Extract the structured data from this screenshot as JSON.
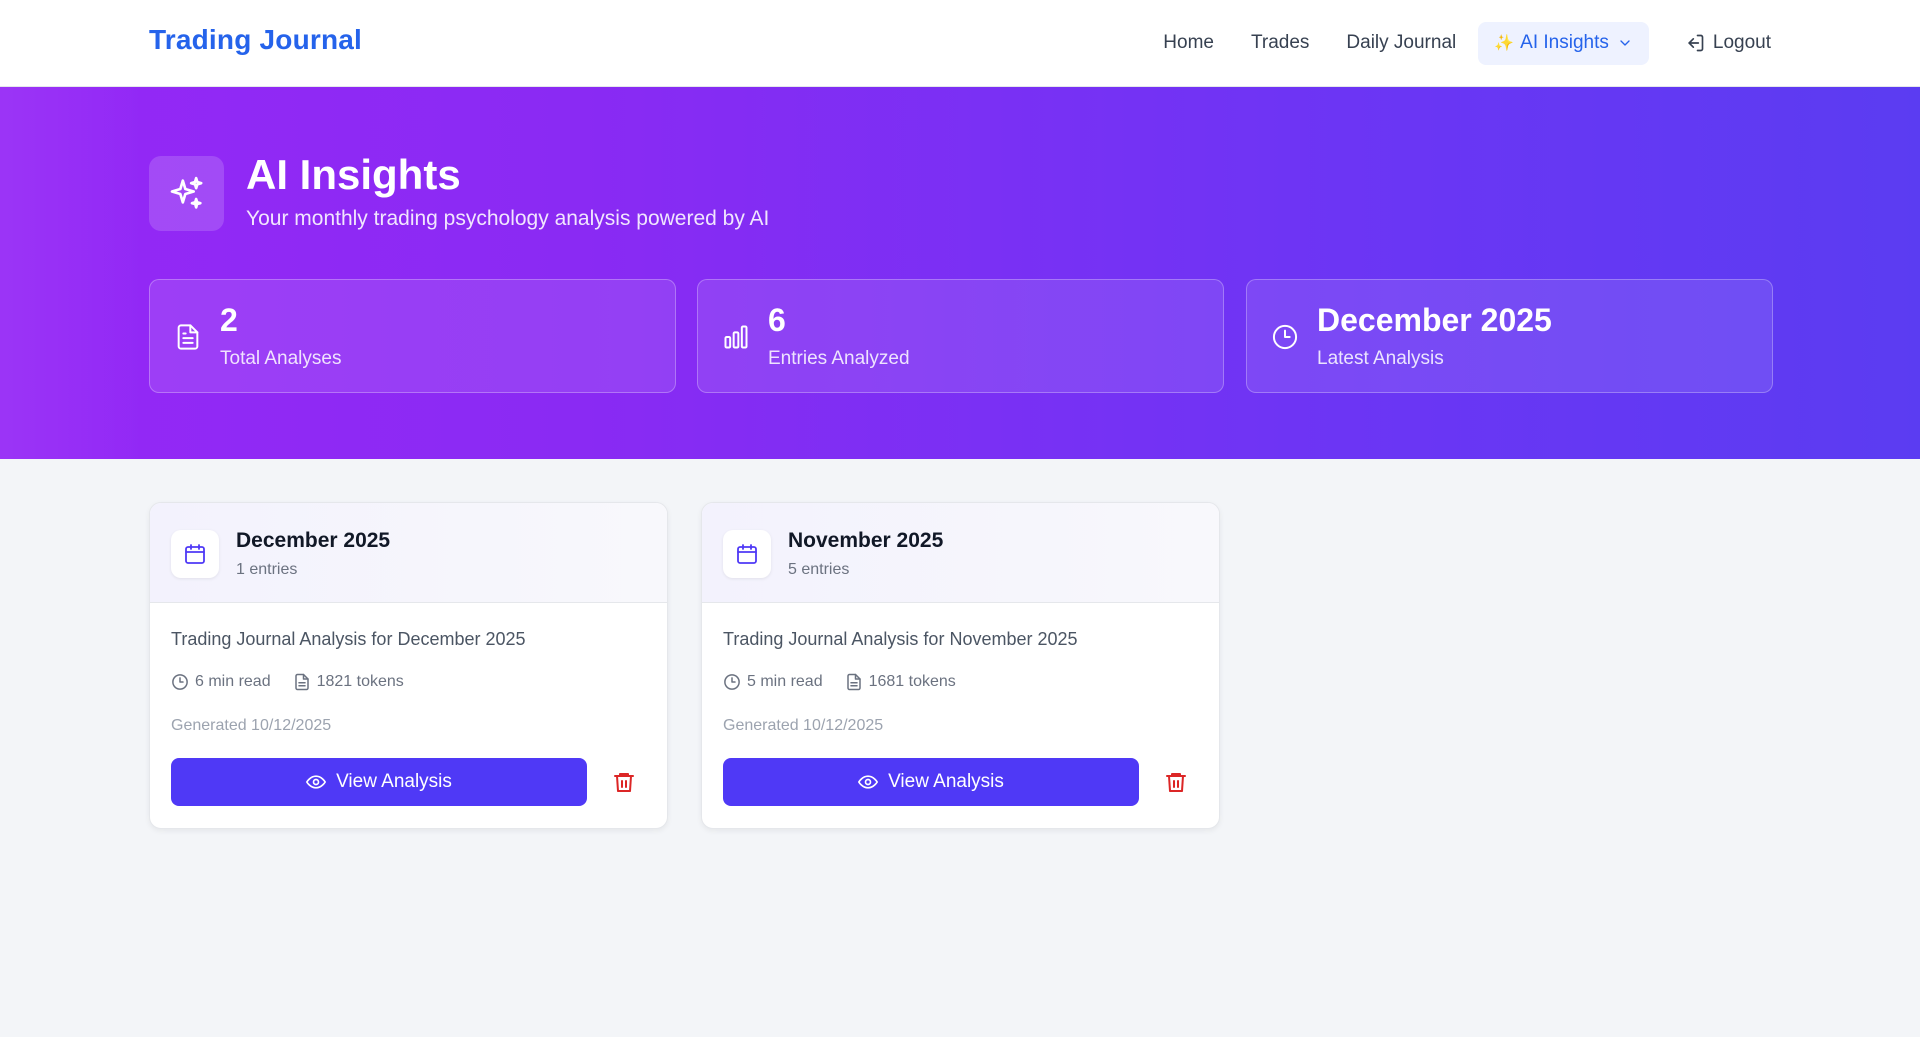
{
  "nav": {
    "brand": "Trading Journal",
    "links": [
      "Home",
      "Trades",
      "Daily Journal"
    ],
    "active": "AI Insights",
    "logout": "Logout"
  },
  "hero": {
    "title": "AI Insights",
    "subtitle": "Your monthly trading psychology analysis powered by AI"
  },
  "stats": [
    {
      "value": "2",
      "label": "Total Analyses",
      "icon": "document-icon"
    },
    {
      "value": "6",
      "label": "Entries Analyzed",
      "icon": "bar-chart-icon"
    },
    {
      "value": "December 2025",
      "label": "Latest Analysis",
      "icon": "clock-icon"
    }
  ],
  "cards": [
    {
      "title": "December 2025",
      "entries": "1 entries",
      "description": "Trading Journal Analysis for December 2025",
      "read_time": "6 min read",
      "tokens": "1821 tokens",
      "generated": "Generated 10/12/2025",
      "button": "View Analysis"
    },
    {
      "title": "November 2025",
      "entries": "5 entries",
      "description": "Trading Journal Analysis for November 2025",
      "read_time": "5 min read",
      "tokens": "1681 tokens",
      "generated": "Generated 10/12/2025",
      "button": "View Analysis"
    }
  ],
  "colors": {
    "brand": "#2563eb",
    "primary_button": "#4f39f6",
    "delete": "#dc2626",
    "hero_start": "#9528f6",
    "hero_end": "#5b3cf2"
  }
}
